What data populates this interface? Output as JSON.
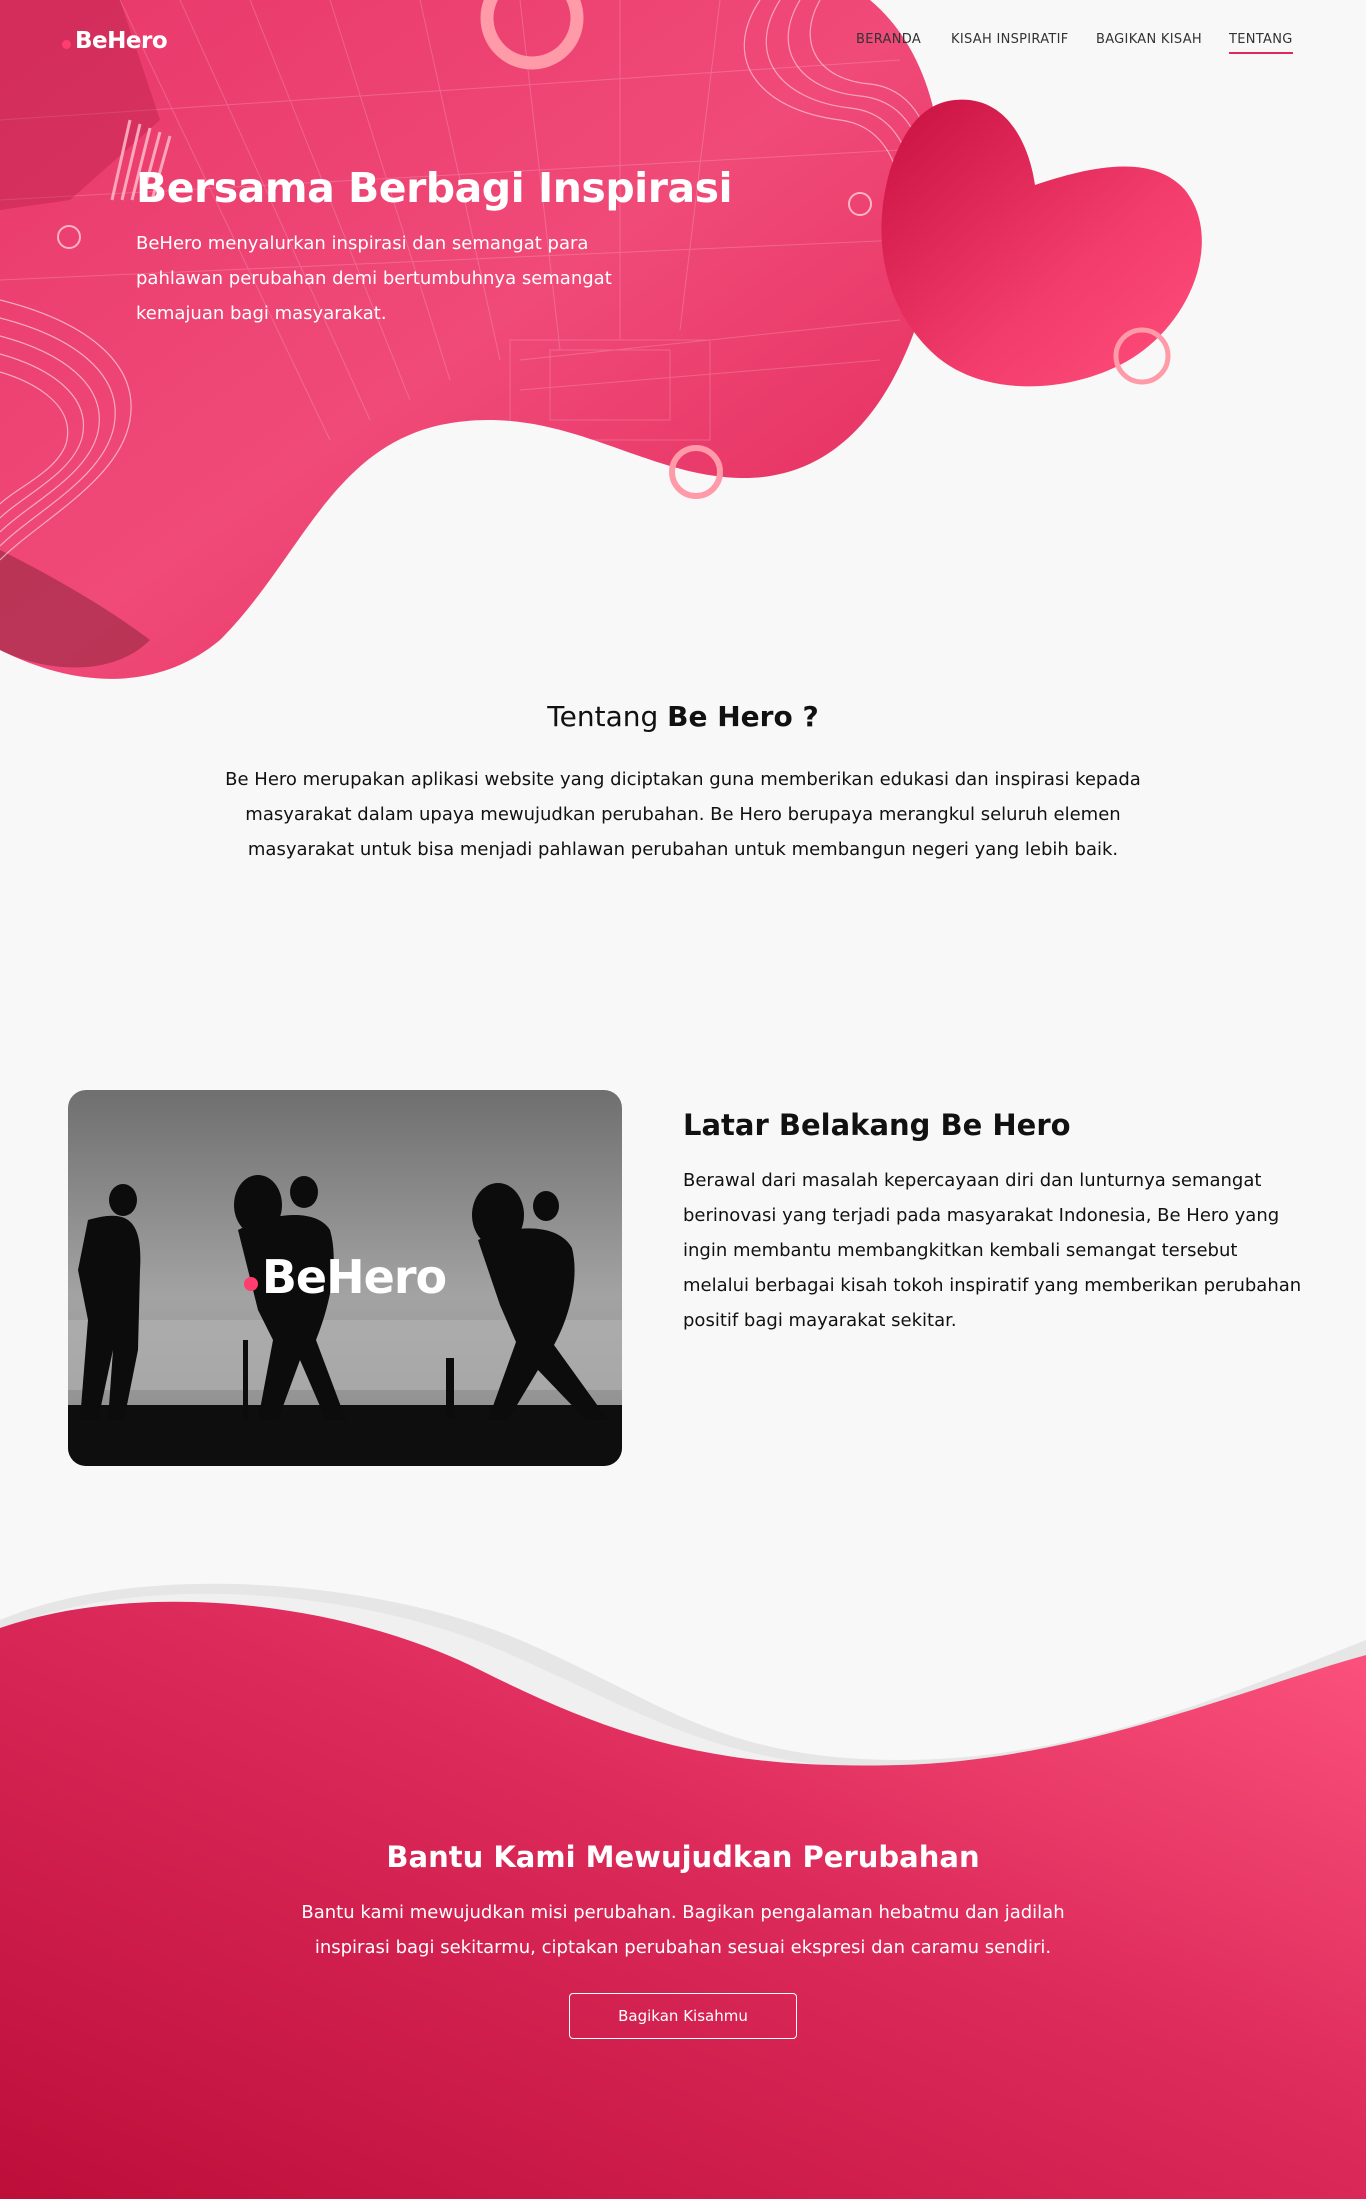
{
  "brand": {
    "name": "BeHero",
    "accent": "#e2285a",
    "dot_color": "#ff3d6e"
  },
  "nav": {
    "items": [
      {
        "label": "BERANDA",
        "active": false
      },
      {
        "label": "KISAH INSPIRATIF",
        "active": false
      },
      {
        "label": "BAGIKAN KISAH",
        "active": false
      },
      {
        "label": "TENTANG",
        "active": true
      }
    ]
  },
  "hero": {
    "title": "Bersama Berbagi Inspirasi",
    "description": "BeHero menyalurkan inspirasi dan semangat para pahlawan perubahan demi bertumbuhnya semangat kemajuan bagi masyarakat."
  },
  "about": {
    "title_prefix": "Tentang ",
    "title_bold": "Be Hero ?",
    "text": "Be Hero merupakan aplikasi website yang diciptakan guna memberikan edukasi dan inspirasi kepada masyarakat dalam upaya mewujudkan perubahan. Be Hero berupaya merangkul seluruh elemen masyarakat untuk bisa menjadi pahlawan perubahan untuk membangun negeri yang lebih baik."
  },
  "background": {
    "image_logo": "BeHero",
    "title": "Latar Belakang Be Hero",
    "text": "Berawal dari masalah kepercayaan diri dan lunturnya semangat berinovasi yang terjadi pada masyarakat Indonesia, Be Hero yang ingin membantu membangkitkan kembali semangat tersebut melalui berbagai kisah tokoh inspiratif yang memberikan perubahan positif bagi mayarakat sekitar."
  },
  "cta": {
    "title": "Bantu Kami Mewujudkan Perubahan",
    "text": "Bantu kami mewujudkan misi perubahan. Bagikan pengalaman hebatmu dan jadilah inspirasi bagi sekitarmu, ciptakan perubahan sesuai ekspresi dan caramu sendiri.",
    "button_label": "Bagikan Kisahmu"
  }
}
